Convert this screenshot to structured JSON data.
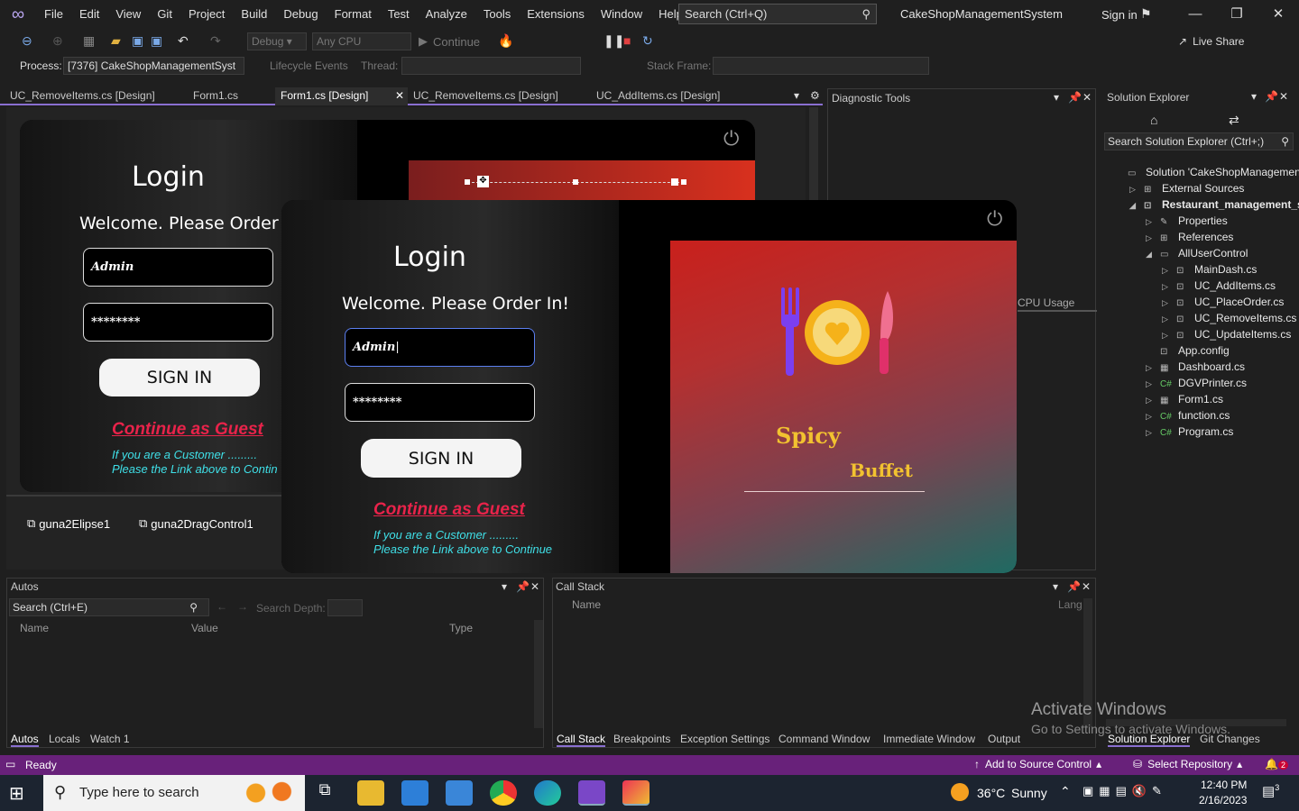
{
  "menu": {
    "items": [
      "File",
      "Edit",
      "View",
      "Git",
      "Project",
      "Build",
      "Debug",
      "Format",
      "Test",
      "Analyze",
      "Tools",
      "Extensions",
      "Window",
      "Help"
    ],
    "search": "Search (Ctrl+Q)",
    "title": "CakeShopManagementSystem",
    "signin": "Sign in"
  },
  "toolbar": {
    "config": "Debug",
    "platform": "Any CPU",
    "continue": "Continue",
    "live_share": "Live Share"
  },
  "toolbar2": {
    "process_label": "Process:",
    "process_value": "[7376] CakeShopManagementSyst",
    "lifecycle": "Lifecycle Events",
    "thread": "Thread:",
    "stack_frame": "Stack Frame:"
  },
  "doc_tabs": [
    "UC_RemoveItems.cs [Design]",
    "Form1.cs",
    "Form1.cs [Design]",
    "UC_RemoveItems.cs [Design]",
    "UC_AddItems.cs [Design]"
  ],
  "form_back": {
    "login": "Login",
    "welcome": "Welcome. Please Order",
    "user": "Admin",
    "pass": "********",
    "signin": "SIGN IN",
    "guest": "Continue as Guest",
    "cust1": "If you are a Customer .........",
    "cust2": "Please the Link above to Contin"
  },
  "form_front": {
    "login": "Login",
    "welcome": "Welcome. Please Order In!",
    "user": "Admin",
    "pass": "********",
    "signin": "SIGN IN",
    "guest": "Continue as Guest",
    "cust1": "If you are a Customer .........",
    "cust2": "Please the Link above to Continue",
    "spicy": "Spicy",
    "buffet": "Buffet"
  },
  "components": [
    "guna2Elipse1",
    "guna2DragControl1"
  ],
  "diagnostic": {
    "title": "Diagnostic Tools",
    "cpu": "CPU Usage"
  },
  "solution": {
    "title": "Solution Explorer",
    "search": "Search Solution Explorer (Ctrl+;)",
    "items": [
      "Solution 'CakeShopManagement",
      "External Sources",
      "Restaurant_management_sy",
      "Properties",
      "References",
      "AllUserControl",
      "MainDash.cs",
      "UC_AddItems.cs",
      "UC_PlaceOrder.cs",
      "UC_RemoveItems.cs",
      "UC_UpdateItems.cs",
      "App.config",
      "Dashboard.cs",
      "DGVPrinter.cs",
      "Form1.cs",
      "function.cs",
      "Program.cs"
    ],
    "tabs": [
      "Solution Explorer",
      "Git Changes"
    ]
  },
  "autos": {
    "title": "Autos",
    "search": "Search (Ctrl+E)",
    "depth": "Search Depth:",
    "cols": [
      "Name",
      "Value",
      "Type"
    ],
    "tabs": [
      "Autos",
      "Locals",
      "Watch 1"
    ]
  },
  "callstack": {
    "title": "Call Stack",
    "cols": [
      "Name",
      "Lang"
    ],
    "tabs": [
      "Call Stack",
      "Breakpoints",
      "Exception Settings",
      "Command Window",
      "Immediate Window",
      "Output"
    ]
  },
  "watermark": {
    "line1": "Activate Windows",
    "line2": "Go to Settings to activate Windows."
  },
  "status": {
    "ready": "Ready",
    "source": "Add to Source Control",
    "repo": "Select Repository",
    "notif": "2"
  },
  "taskbar": {
    "search": "Type here to search",
    "weather_temp": "36°C",
    "weather": "Sunny",
    "time": "12:40 PM",
    "date": "2/16/2023",
    "notif": "3"
  },
  "colors": {
    "accent": "#68217a",
    "tab_underline": "#8a6fd1",
    "guest": "#e8234a",
    "customer_text": "#3fe0e8",
    "spicy": "#f2c230"
  }
}
